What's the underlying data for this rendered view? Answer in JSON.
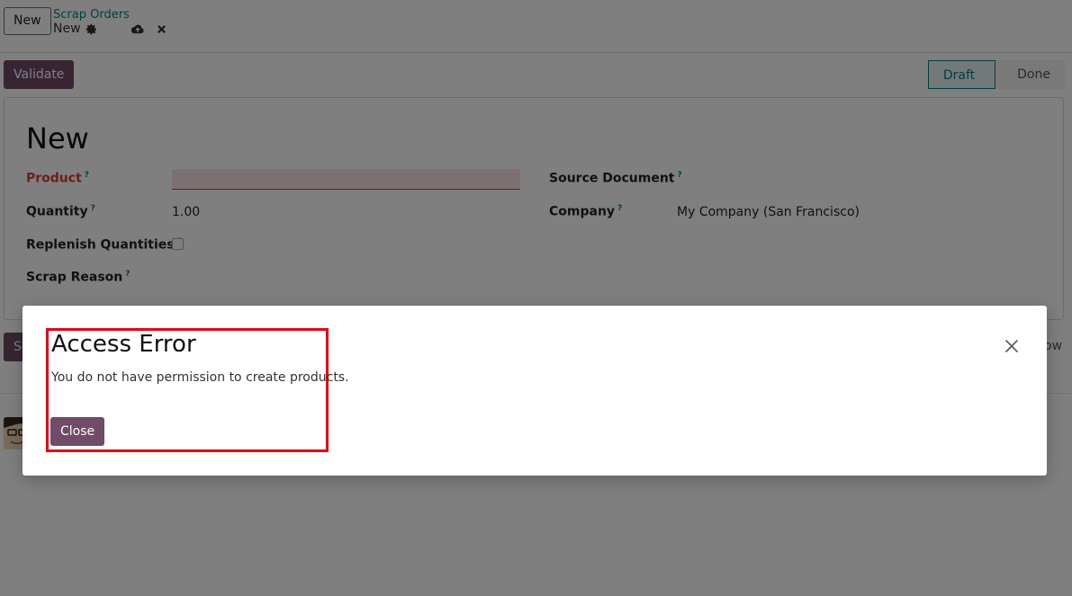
{
  "control_panel": {
    "new_button": "New",
    "breadcrumb_parent": "Scrap Orders",
    "breadcrumb_current": "New"
  },
  "actions": {
    "validate": "Validate"
  },
  "statusbar": {
    "steps": [
      "Draft",
      "Done"
    ],
    "active": "Draft"
  },
  "form": {
    "title": "New",
    "product_label": "Product",
    "quantity_label": "Quantity",
    "quantity_value": "1.00",
    "replenish_label": "Replenish Quantities",
    "scrap_reason_label": "Scrap Reason",
    "source_document_label": "Source Document",
    "company_label": "Company",
    "company_value": "My Company (San Francisco)",
    "help_mark": "?"
  },
  "chatter": {
    "partial_button": "Se",
    "partial_right": "ow"
  },
  "dialog": {
    "title": "Access Error",
    "message": "You do not have permission to create products.",
    "close_button": "Close"
  },
  "icons": [
    "gear-icon",
    "cloud-upload-icon",
    "discard-icon",
    "close-icon"
  ],
  "colors": {
    "accent": "#714b67",
    "teal": "#017e84",
    "required": "#d23f3a",
    "highlight": "#e30613"
  }
}
